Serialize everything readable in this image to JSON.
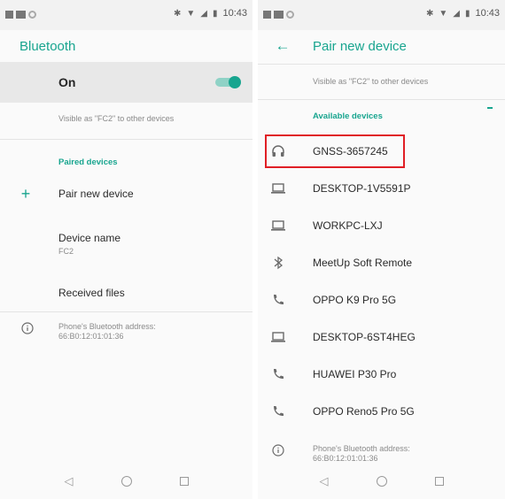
{
  "left_panel": {
    "status": {
      "time": "10:43"
    },
    "title": "Bluetooth",
    "toggle_label": "On",
    "toggle_on": true,
    "visible_as": "Visible as \"FC2\" to other devices",
    "paired_header": "Paired devices",
    "pair_new_label": "Pair new device",
    "device_name_label": "Device name",
    "device_name_value": "FC2",
    "received_files_label": "Received files",
    "address_label": "Phone's Bluetooth address:",
    "address_value": "66:B0:12:01:01:36"
  },
  "right_panel": {
    "status": {
      "time": "10:43"
    },
    "title": "Pair new device",
    "visible_as": "Visible as \"FC2\" to other devices",
    "available_header": "Available devices",
    "devices": [
      {
        "icon": "headphones-icon",
        "name": "GNSS-3657245"
      },
      {
        "icon": "laptop-icon",
        "name": "DESKTOP-1V5591P"
      },
      {
        "icon": "laptop-icon",
        "name": "WORKPC-LXJ"
      },
      {
        "icon": "bluetooth-icon",
        "name": "MeetUp Soft Remote"
      },
      {
        "icon": "phone-icon",
        "name": "OPPO K9 Pro 5G"
      },
      {
        "icon": "laptop-icon",
        "name": "DESKTOP-6ST4HEG"
      },
      {
        "icon": "phone-icon",
        "name": "HUAWEI P30 Pro"
      },
      {
        "icon": "phone-icon",
        "name": "OPPO Reno5 Pro 5G"
      }
    ],
    "address_label": "Phone's Bluetooth address:",
    "address_value": "66:B0:12:01:01:36"
  },
  "colors": {
    "accent": "#18a58f",
    "highlight": "#e01f25"
  }
}
